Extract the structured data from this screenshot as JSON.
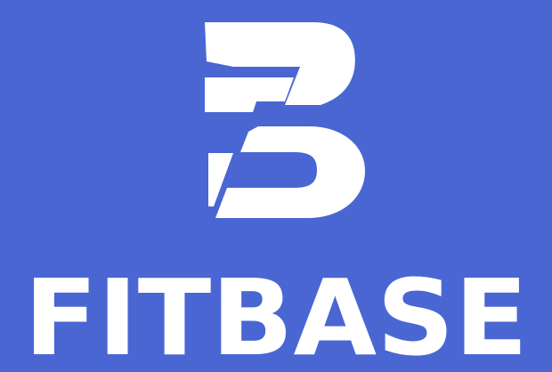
{
  "brand": {
    "wordmark": "FITBASE",
    "logo_icon": "stylized-b-monogram",
    "background_color": "#4a66d3",
    "foreground_color": "#ffffff"
  }
}
